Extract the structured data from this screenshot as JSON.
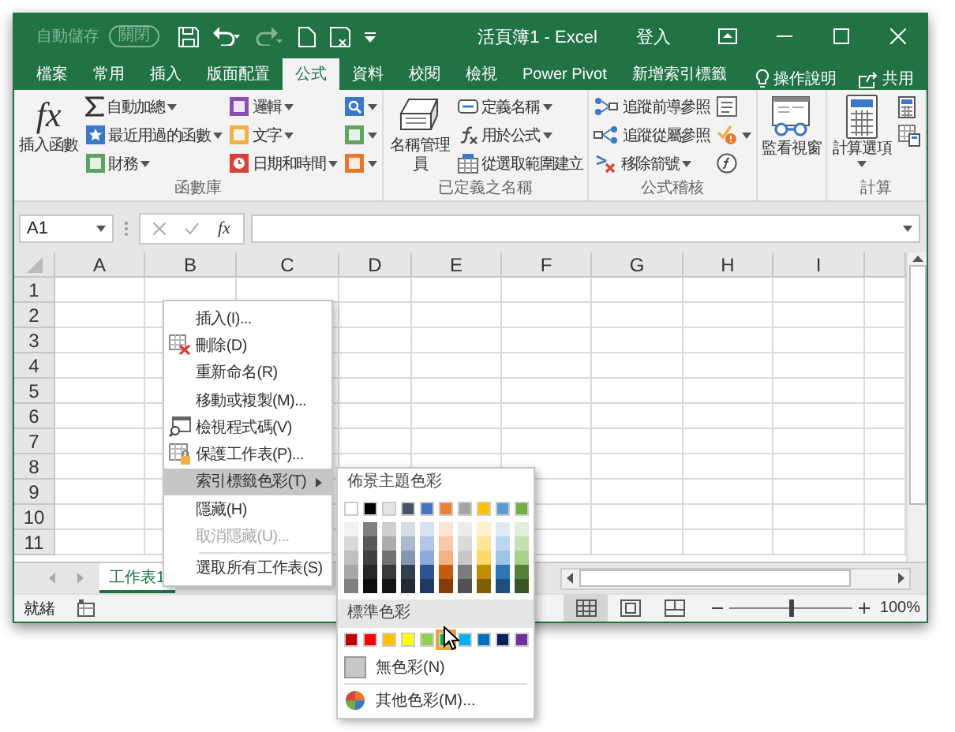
{
  "title_bar": {
    "autosave_label": "自動儲存",
    "autosave_state": "關閉",
    "title": "活頁簿1 - Excel",
    "sign_in": "登入"
  },
  "ribbon_tabs": [
    {
      "label": "檔案",
      "selected": false
    },
    {
      "label": "常用",
      "selected": false
    },
    {
      "label": "插入",
      "selected": false
    },
    {
      "label": "版面配置",
      "selected": false
    },
    {
      "label": "公式",
      "selected": true
    },
    {
      "label": "資料",
      "selected": false
    },
    {
      "label": "校閱",
      "selected": false
    },
    {
      "label": "檢視",
      "selected": false
    },
    {
      "label": "Power Pivot",
      "selected": false
    },
    {
      "label": "新增索引標籤",
      "selected": false
    }
  ],
  "tell_me": "操作說明",
  "share": "共用",
  "ribbon_groups": [
    {
      "label": "函數庫",
      "big": [
        {
          "label": "插入函數",
          "kind": "fx",
          "icon_text": "fx",
          "dropdown": false
        }
      ],
      "columns": [
        [
          {
            "label": "自動加總",
            "kind": "sum",
            "dropdown": true
          },
          {
            "label": "最近用過的函數",
            "kind": "recent",
            "dropdown": true
          },
          {
            "label": "財務",
            "kind": "finance",
            "dropdown": true
          }
        ],
        [
          {
            "label": "邏輯",
            "kind": "logic",
            "dropdown": true
          },
          {
            "label": "文字",
            "kind": "text",
            "dropdown": true
          },
          {
            "label": "日期和時間",
            "kind": "date",
            "dropdown": true
          }
        ],
        [
          {
            "kind": "lookup",
            "dropdown": true
          },
          {
            "kind": "math",
            "dropdown": true
          },
          {
            "kind": "more",
            "dropdown": true
          }
        ]
      ]
    },
    {
      "label": "已定義之名稱",
      "big": [
        {
          "label": "名稱管理員",
          "kind": "name_manager",
          "dropdown": false
        }
      ],
      "columns": [
        [
          {
            "label": "定義名稱",
            "kind": "define",
            "dropdown": true
          },
          {
            "label": "用於公式",
            "kind": "use_formula",
            "dropdown": true
          },
          {
            "label": "從選取範圍建立",
            "kind": "create",
            "dropdown": false
          }
        ]
      ]
    },
    {
      "label": "公式稽核",
      "columns": [
        [
          {
            "label": "追蹤前導參照",
            "kind": "trace_prec",
            "dropdown": false
          },
          {
            "label": "追蹤從屬參照",
            "kind": "trace_dep",
            "dropdown": false
          },
          {
            "label": "移除箭號",
            "kind": "remove_arrows",
            "dropdown": true
          }
        ],
        [
          {
            "kind": "show_formulas",
            "dropdown": false
          },
          {
            "kind": "error_check",
            "dropdown": true
          },
          {
            "kind": "evaluate",
            "dropdown": false
          }
        ]
      ]
    },
    {
      "big": [
        {
          "label": "監看視窗",
          "kind": "watch",
          "dropdown": false
        }
      ]
    },
    {
      "label": "計算",
      "big": [
        {
          "label": "計算選項",
          "kind": "calc_options",
          "dropdown": true
        }
      ],
      "columns": [
        [
          {
            "kind": "calc_now",
            "dropdown": false
          },
          {
            "kind": "calc_sheet",
            "dropdown": false
          }
        ]
      ]
    }
  ],
  "formula_bar": {
    "name_box": "A1",
    "function_button": "fx"
  },
  "grid": {
    "columns": [
      "A",
      "B",
      "C",
      "D",
      "E",
      "F",
      "G",
      "H",
      "I"
    ],
    "rows": [
      "1",
      "2",
      "3",
      "4",
      "5",
      "6",
      "7",
      "8",
      "9",
      "10",
      "11"
    ]
  },
  "sheet_tabs": [
    {
      "label": "工作表1",
      "selected": true
    }
  ],
  "status_bar": {
    "ready": "就緒",
    "views": [
      {
        "kind": "normal",
        "selected": true
      },
      {
        "kind": "page_layout",
        "selected": false
      },
      {
        "kind": "page_break",
        "selected": false
      }
    ],
    "zoom": {
      "level": 0.5,
      "reading": "100%"
    }
  },
  "context_menu": {
    "items": [
      {
        "label": "插入(I)...",
        "kind": "plain",
        "selected": false,
        "disabled": false,
        "submenu": false
      },
      {
        "label": "刪除(D)",
        "kind": "delete",
        "selected": false,
        "disabled": false,
        "submenu": false
      },
      {
        "label": "重新命名(R)",
        "kind": "plain",
        "selected": false,
        "disabled": false,
        "submenu": false
      },
      {
        "label": "移動或複製(M)...",
        "kind": "plain",
        "selected": false,
        "disabled": false,
        "submenu": false
      },
      {
        "label": "檢視程式碼(V)",
        "kind": "code",
        "selected": false,
        "disabled": false,
        "submenu": false
      },
      {
        "label": "保護工作表(P)...",
        "kind": "protect",
        "selected": false,
        "disabled": false,
        "submenu": false
      },
      {
        "label": "索引標籤色彩(T)",
        "kind": "plain",
        "selected": true,
        "disabled": false,
        "submenu": true
      },
      {
        "label": "隱藏(H)",
        "kind": "plain",
        "selected": false,
        "disabled": false,
        "submenu": false
      },
      {
        "label": "取消隱藏(U)...",
        "kind": "plain",
        "selected": false,
        "disabled": true,
        "submenu": false
      },
      {
        "label": "選取所有工作表(S)",
        "kind": "plain",
        "selected": false,
        "disabled": false,
        "submenu": false
      }
    ]
  },
  "color_picker": {
    "theme_title": "佈景主題色彩",
    "theme_colors": [
      {
        "color": "#ffffff",
        "shades": [
          {
            "color": "#f2f2f2"
          },
          {
            "color": "#d9d9d9"
          },
          {
            "color": "#bfbfbf"
          },
          {
            "color": "#a6a6a6"
          },
          {
            "color": "#808080"
          }
        ]
      },
      {
        "color": "#000000",
        "shades": [
          {
            "color": "#7f7f7f"
          },
          {
            "color": "#595959"
          },
          {
            "color": "#404040"
          },
          {
            "color": "#262626"
          },
          {
            "color": "#0d0d0d"
          }
        ]
      },
      {
        "color": "#e7e6e6",
        "shades": [
          {
            "color": "#d0cece"
          },
          {
            "color": "#aeabab"
          },
          {
            "color": "#757171"
          },
          {
            "color": "#3a3838"
          },
          {
            "color": "#171616"
          }
        ]
      },
      {
        "color": "#44546a",
        "shades": [
          {
            "color": "#d6dce4"
          },
          {
            "color": "#adb9ca"
          },
          {
            "color": "#8497b0"
          },
          {
            "color": "#333f4f"
          },
          {
            "color": "#222a35"
          }
        ]
      },
      {
        "color": "#4472c4",
        "shades": [
          {
            "color": "#d9e2f3"
          },
          {
            "color": "#b4c6e7"
          },
          {
            "color": "#8eaadb"
          },
          {
            "color": "#2f5496"
          },
          {
            "color": "#1f3864"
          }
        ]
      },
      {
        "color": "#ed7d31",
        "shades": [
          {
            "color": "#fbe5d5"
          },
          {
            "color": "#f7cbac"
          },
          {
            "color": "#f4b183"
          },
          {
            "color": "#c55a11"
          },
          {
            "color": "#843c0b"
          }
        ]
      },
      {
        "color": "#a5a5a5",
        "shades": [
          {
            "color": "#ededed"
          },
          {
            "color": "#dbdbdb"
          },
          {
            "color": "#c9c9c9"
          },
          {
            "color": "#7b7b7b"
          },
          {
            "color": "#525252"
          }
        ]
      },
      {
        "color": "#ffc000",
        "shades": [
          {
            "color": "#fff2cc"
          },
          {
            "color": "#ffe599"
          },
          {
            "color": "#ffd966"
          },
          {
            "color": "#bf8f00"
          },
          {
            "color": "#7f6000"
          }
        ]
      },
      {
        "color": "#5b9bd5",
        "shades": [
          {
            "color": "#deebf6"
          },
          {
            "color": "#bdd7ee"
          },
          {
            "color": "#9dc3e6"
          },
          {
            "color": "#2e75b5"
          },
          {
            "color": "#1e4e79"
          }
        ]
      },
      {
        "color": "#70ad47",
        "shades": [
          {
            "color": "#e2efd9"
          },
          {
            "color": "#c5e0b3"
          },
          {
            "color": "#a8d08d"
          },
          {
            "color": "#538135"
          },
          {
            "color": "#375623"
          }
        ]
      }
    ],
    "standard_title": "標準色彩",
    "standard_colors": [
      {
        "color": "#c00000",
        "selected": false
      },
      {
        "color": "#ff0000",
        "selected": false
      },
      {
        "color": "#ffc000",
        "selected": false
      },
      {
        "color": "#ffff00",
        "selected": false
      },
      {
        "color": "#92d050",
        "selected": false
      },
      {
        "color": "#00b050",
        "selected": true
      },
      {
        "color": "#00b0f0",
        "selected": false
      },
      {
        "color": "#0070c0",
        "selected": false
      },
      {
        "color": "#002060",
        "selected": false
      },
      {
        "color": "#7030a0",
        "selected": false
      }
    ],
    "no_color": "無色彩(N)",
    "more_colors": "其他色彩(M)..."
  }
}
